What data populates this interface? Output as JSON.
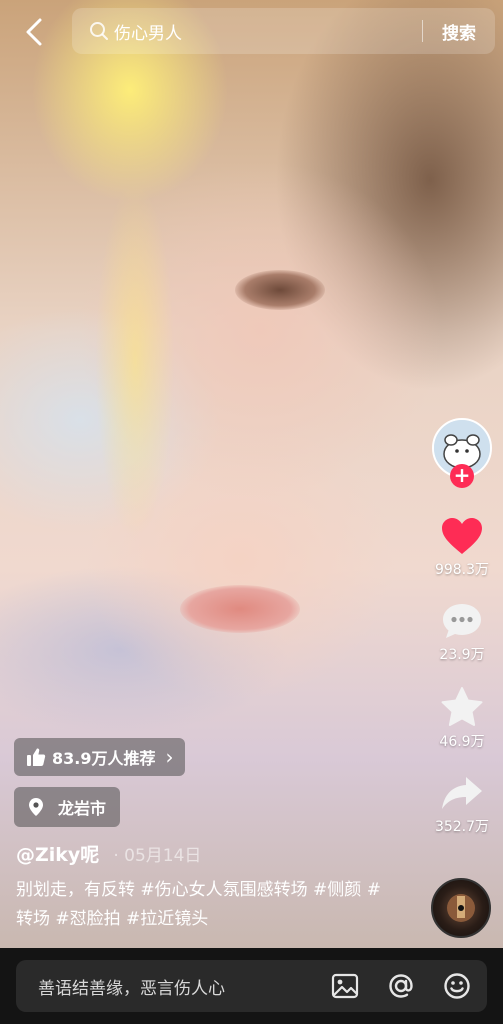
{
  "search": {
    "query": "伤心男人",
    "button": "搜索"
  },
  "rail": {
    "like_count": "998.3万",
    "comment_count": "23.9万",
    "favorite_count": "46.9万",
    "share_count": "352.7万"
  },
  "recommend": {
    "label": "83.9万人推荐",
    "arrow": "›"
  },
  "location": {
    "label": "龙岩市"
  },
  "author": {
    "name": "@Ziky呢",
    "date": "05月14日"
  },
  "caption": "别划走，有反转 #伤心女人氛围感转场 #侧颜 #转场 #怼脸拍 #拉近镜头",
  "comment_bar": {
    "placeholder": "善语结善缘，恶言伤人心"
  },
  "colors": {
    "accent": "#fe2c55",
    "bottom_bar": "#141414"
  },
  "icons": [
    "back-icon",
    "search-icon",
    "like-icon",
    "comment-icon",
    "favorite-icon",
    "share-icon",
    "thumbs-up-icon",
    "location-pin-icon",
    "image-icon",
    "at-icon",
    "emoji-icon",
    "music-disc-icon"
  ]
}
